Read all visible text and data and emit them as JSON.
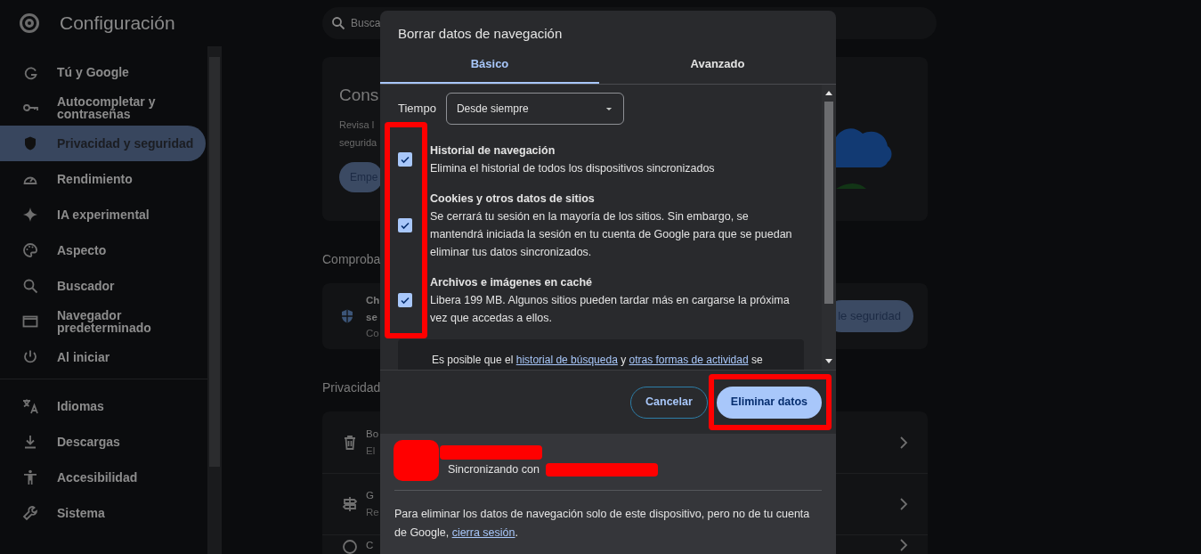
{
  "header": {
    "title": "Configuración",
    "search_placeholder": "Busca"
  },
  "sidebar": {
    "groups": [
      [
        {
          "label": "Tú y Google",
          "selected": false
        },
        {
          "label": "Autocompletar y contraseñas",
          "selected": false
        },
        {
          "label": "Privacidad y seguridad",
          "selected": true
        },
        {
          "label": "Rendimiento",
          "selected": false
        },
        {
          "label": "IA experimental",
          "selected": false
        },
        {
          "label": "Aspecto",
          "selected": false
        },
        {
          "label": "Buscador",
          "selected": false
        },
        {
          "label": "Navegador predeterminado",
          "selected": false
        },
        {
          "label": "Al iniciar",
          "selected": false
        }
      ],
      [
        {
          "label": "Idiomas",
          "selected": false
        },
        {
          "label": "Descargas",
          "selected": false
        },
        {
          "label": "Accesibilidad",
          "selected": false
        },
        {
          "label": "Sistema",
          "selected": false
        }
      ]
    ]
  },
  "main": {
    "guide_card": {
      "title": "Cons",
      "description": [
        "Revisa l",
        "segurida"
      ],
      "button": "Empe"
    },
    "safety_heading": "Comproba",
    "safety_card": {
      "title": [
        "Ch",
        "se"
      ],
      "subtitle": "Co",
      "button": "le seguridad"
    },
    "privacy_heading": "Privacidad",
    "privacy_rows": [
      {
        "title": "Bo",
        "subtitle": "El"
      },
      {
        "title": "G",
        "subtitle": "Re"
      },
      {
        "title": "C"
      }
    ]
  },
  "dialog": {
    "title": "Borrar datos de navegación",
    "tabs": [
      {
        "label": "Básico",
        "selected": true
      },
      {
        "label": "Avanzado",
        "selected": false
      }
    ],
    "time_label": "Tiempo",
    "time_value": "Desde siempre",
    "options": [
      {
        "title": "Historial de navegación",
        "description": "Elimina el historial de todos los dispositivos sincronizados",
        "checked": true
      },
      {
        "title": "Cookies y otros datos de sitios",
        "description": "Se cerrará tu sesión en la mayoría de los sitios. Sin embargo, se mantendrá iniciada la sesión en tu cuenta de Google para que se puedan eliminar tus datos sincronizados.",
        "checked": true
      },
      {
        "title": "Archivos e imágenes en caché",
        "description": "Libera 199 MB. Algunos sitios pueden tardar más en cargarse la próxima vez que accedas a ellos.",
        "checked": true
      }
    ],
    "notice": [
      {
        "text": "Es posible que el ",
        "link": false
      },
      {
        "text": "historial de búsqueda",
        "link": true
      },
      {
        "text": " y ",
        "link": false
      },
      {
        "text": "otras formas de actividad",
        "link": true
      },
      {
        "text": " se",
        "link": false
      }
    ],
    "buttons": [
      {
        "label": "Cancelar",
        "kind": "secondary"
      },
      {
        "label": "Eliminar datos",
        "kind": "primary"
      }
    ],
    "account_status": "Sincronizando con",
    "footer": [
      {
        "text": "Para eliminar los datos de navegación solo de este dispositivo, pero no de tu cuenta de Google, ",
        "link": false
      },
      {
        "text": "cierra sesión",
        "link": true
      },
      {
        "text": ".",
        "link": false
      }
    ]
  }
}
